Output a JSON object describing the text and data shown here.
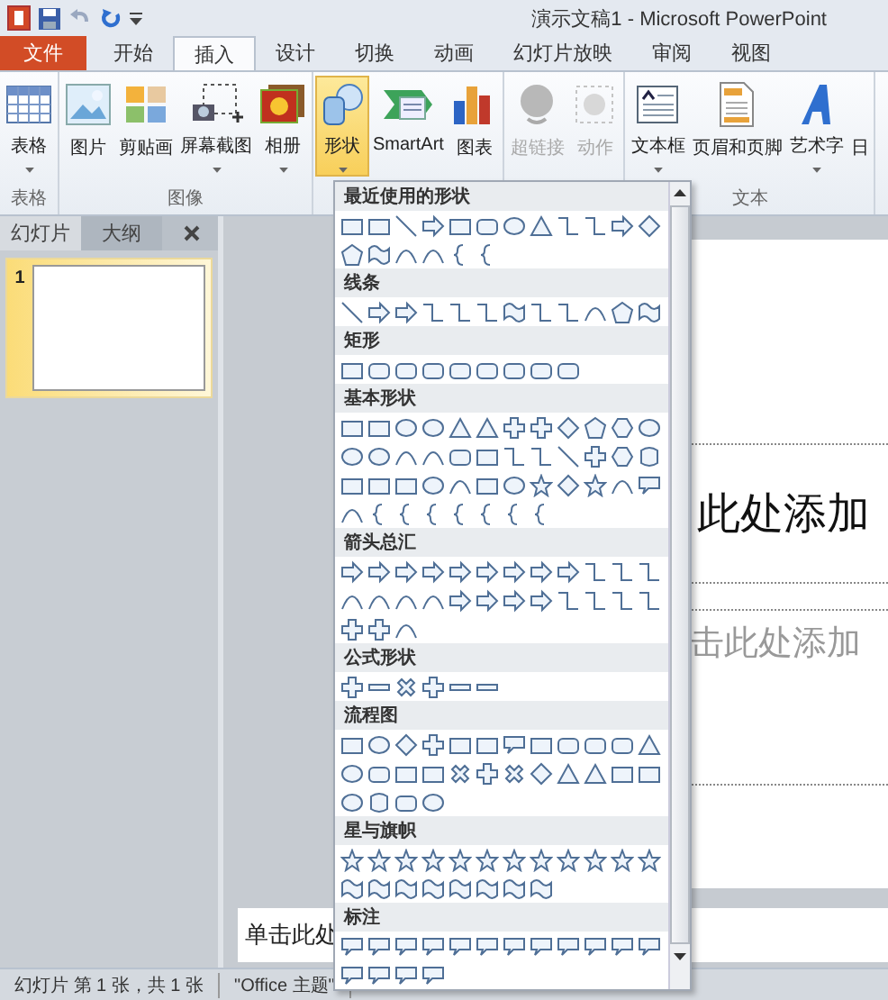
{
  "window": {
    "title": "演示文稿1  -  Microsoft PowerPoint"
  },
  "tabs": [
    {
      "label": "文件",
      "kind": "file",
      "selected": false
    },
    {
      "label": "开始",
      "kind": "tab",
      "selected": false
    },
    {
      "label": "插入",
      "kind": "tab",
      "selected": true
    },
    {
      "label": "设计",
      "kind": "tab",
      "selected": false
    },
    {
      "label": "切换",
      "kind": "tab",
      "selected": false
    },
    {
      "label": "动画",
      "kind": "tab",
      "selected": false
    },
    {
      "label": "幻灯片放映",
      "kind": "tab",
      "selected": false
    },
    {
      "label": "审阅",
      "kind": "tab",
      "selected": false
    },
    {
      "label": "视图",
      "kind": "tab",
      "selected": false
    }
  ],
  "ribbon_groups": [
    {
      "label": "表格",
      "buttons": [
        {
          "label": "表格",
          "kind": "table",
          "has_menu": true,
          "disabled": false,
          "selected": false
        }
      ]
    },
    {
      "label": "图像",
      "buttons": [
        {
          "label": "图片",
          "kind": "picture",
          "has_menu": false,
          "disabled": false,
          "selected": false
        },
        {
          "label": "剪贴画",
          "kind": "clipart",
          "has_menu": false,
          "disabled": false,
          "selected": false
        },
        {
          "label": "屏幕截图",
          "kind": "screenshot",
          "has_menu": true,
          "disabled": false,
          "selected": false
        },
        {
          "label": "相册",
          "kind": "album",
          "has_menu": true,
          "disabled": false,
          "selected": false
        }
      ]
    },
    {
      "buttons": [
        {
          "label": "形状",
          "kind": "shapes",
          "has_menu": true,
          "disabled": false,
          "selected": true
        },
        {
          "label": "SmartArt",
          "kind": "smartart",
          "has_menu": false,
          "disabled": false,
          "selected": false
        },
        {
          "label": "图表",
          "kind": "chart",
          "has_menu": false,
          "disabled": false,
          "selected": false
        }
      ]
    },
    {
      "buttons": [
        {
          "label": "超链接",
          "kind": "link",
          "has_menu": false,
          "disabled": true,
          "selected": false
        },
        {
          "label": "动作",
          "kind": "action",
          "has_menu": false,
          "disabled": true,
          "selected": false
        }
      ]
    },
    {
      "label": "文本",
      "buttons": [
        {
          "label": "文本框",
          "kind": "textbox",
          "has_menu": true,
          "disabled": false,
          "selected": false
        },
        {
          "label": "页眉和页脚",
          "kind": "header",
          "has_menu": false,
          "disabled": false,
          "selected": false
        },
        {
          "label": "艺术字",
          "kind": "wordart",
          "has_menu": true,
          "disabled": false,
          "selected": false
        },
        {
          "label": "日",
          "kind": "none"
        }
      ]
    }
  ],
  "panel_tabs": [
    {
      "label": "幻灯片",
      "selected": true
    },
    {
      "label": "大纲",
      "selected": false
    }
  ],
  "thumbnails": [
    {
      "number": "1",
      "selected": true
    }
  ],
  "slide": {
    "title": "此处添加",
    "subtitle": "击此处添加"
  },
  "notes": {
    "text": "单击此处"
  },
  "shapes_menu": {
    "sections": [
      {
        "title": "最近使用的形状"
      },
      {
        "title": "线条"
      },
      {
        "title": "矩形"
      },
      {
        "title": "基本形状"
      },
      {
        "title": "箭头总汇"
      },
      {
        "title": "公式形状"
      },
      {
        "title": "流程图"
      },
      {
        "title": "星与旗帜"
      },
      {
        "title": "标注"
      }
    ]
  },
  "status_bar": [
    "幻灯片 第 1 张，共 1 张",
    "\"Office 主题\""
  ]
}
